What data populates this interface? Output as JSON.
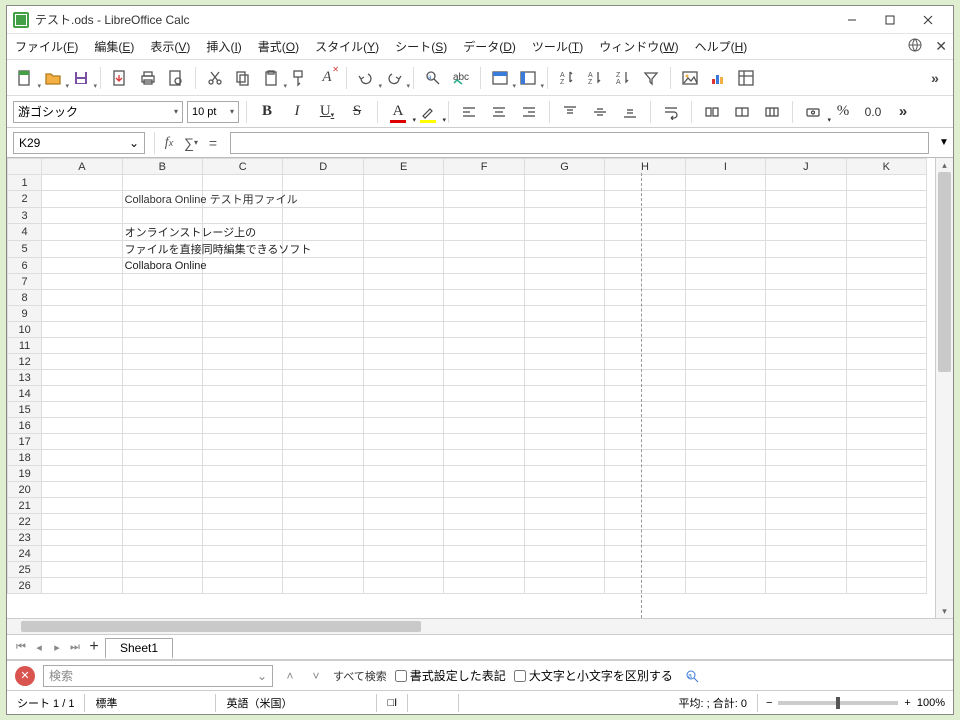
{
  "window": {
    "title": "テスト.ods - LibreOffice Calc"
  },
  "menu": [
    {
      "label": "ファイル",
      "key": "F"
    },
    {
      "label": "編集",
      "key": "E"
    },
    {
      "label": "表示",
      "key": "V"
    },
    {
      "label": "挿入",
      "key": "I"
    },
    {
      "label": "書式",
      "key": "O"
    },
    {
      "label": "スタイル",
      "key": "Y"
    },
    {
      "label": "シート",
      "key": "S"
    },
    {
      "label": "データ",
      "key": "D"
    },
    {
      "label": "ツール",
      "key": "T"
    },
    {
      "label": "ウィンドウ",
      "key": "W"
    },
    {
      "label": "ヘルプ",
      "key": "H"
    }
  ],
  "format": {
    "font": "游ゴシック",
    "size": "10 pt"
  },
  "formula": {
    "cell_ref": "K29"
  },
  "columns": [
    "A",
    "B",
    "C",
    "D",
    "E",
    "F",
    "G",
    "H",
    "I",
    "J",
    "K"
  ],
  "selected_col": "K",
  "rows": 26,
  "cells": {
    "B2": "Collabora Online テスト用ファイル",
    "B4": "オンラインストレージ上の",
    "B5": "ファイルを直接同時編集できるソフト",
    "B6": "Collabora Online"
  },
  "tabs": {
    "active": "Sheet1"
  },
  "find": {
    "placeholder": "検索",
    "search_all": "すべて検索",
    "match_format": "書式設定した表記",
    "match_case": "大文字と小文字を区別する"
  },
  "status": {
    "sheet": "シート 1 / 1",
    "style": "標準",
    "lang": "英語（米国）",
    "insmode_icon": "□I",
    "stats": "平均: ; 合計: 0",
    "zoom": "100%"
  }
}
